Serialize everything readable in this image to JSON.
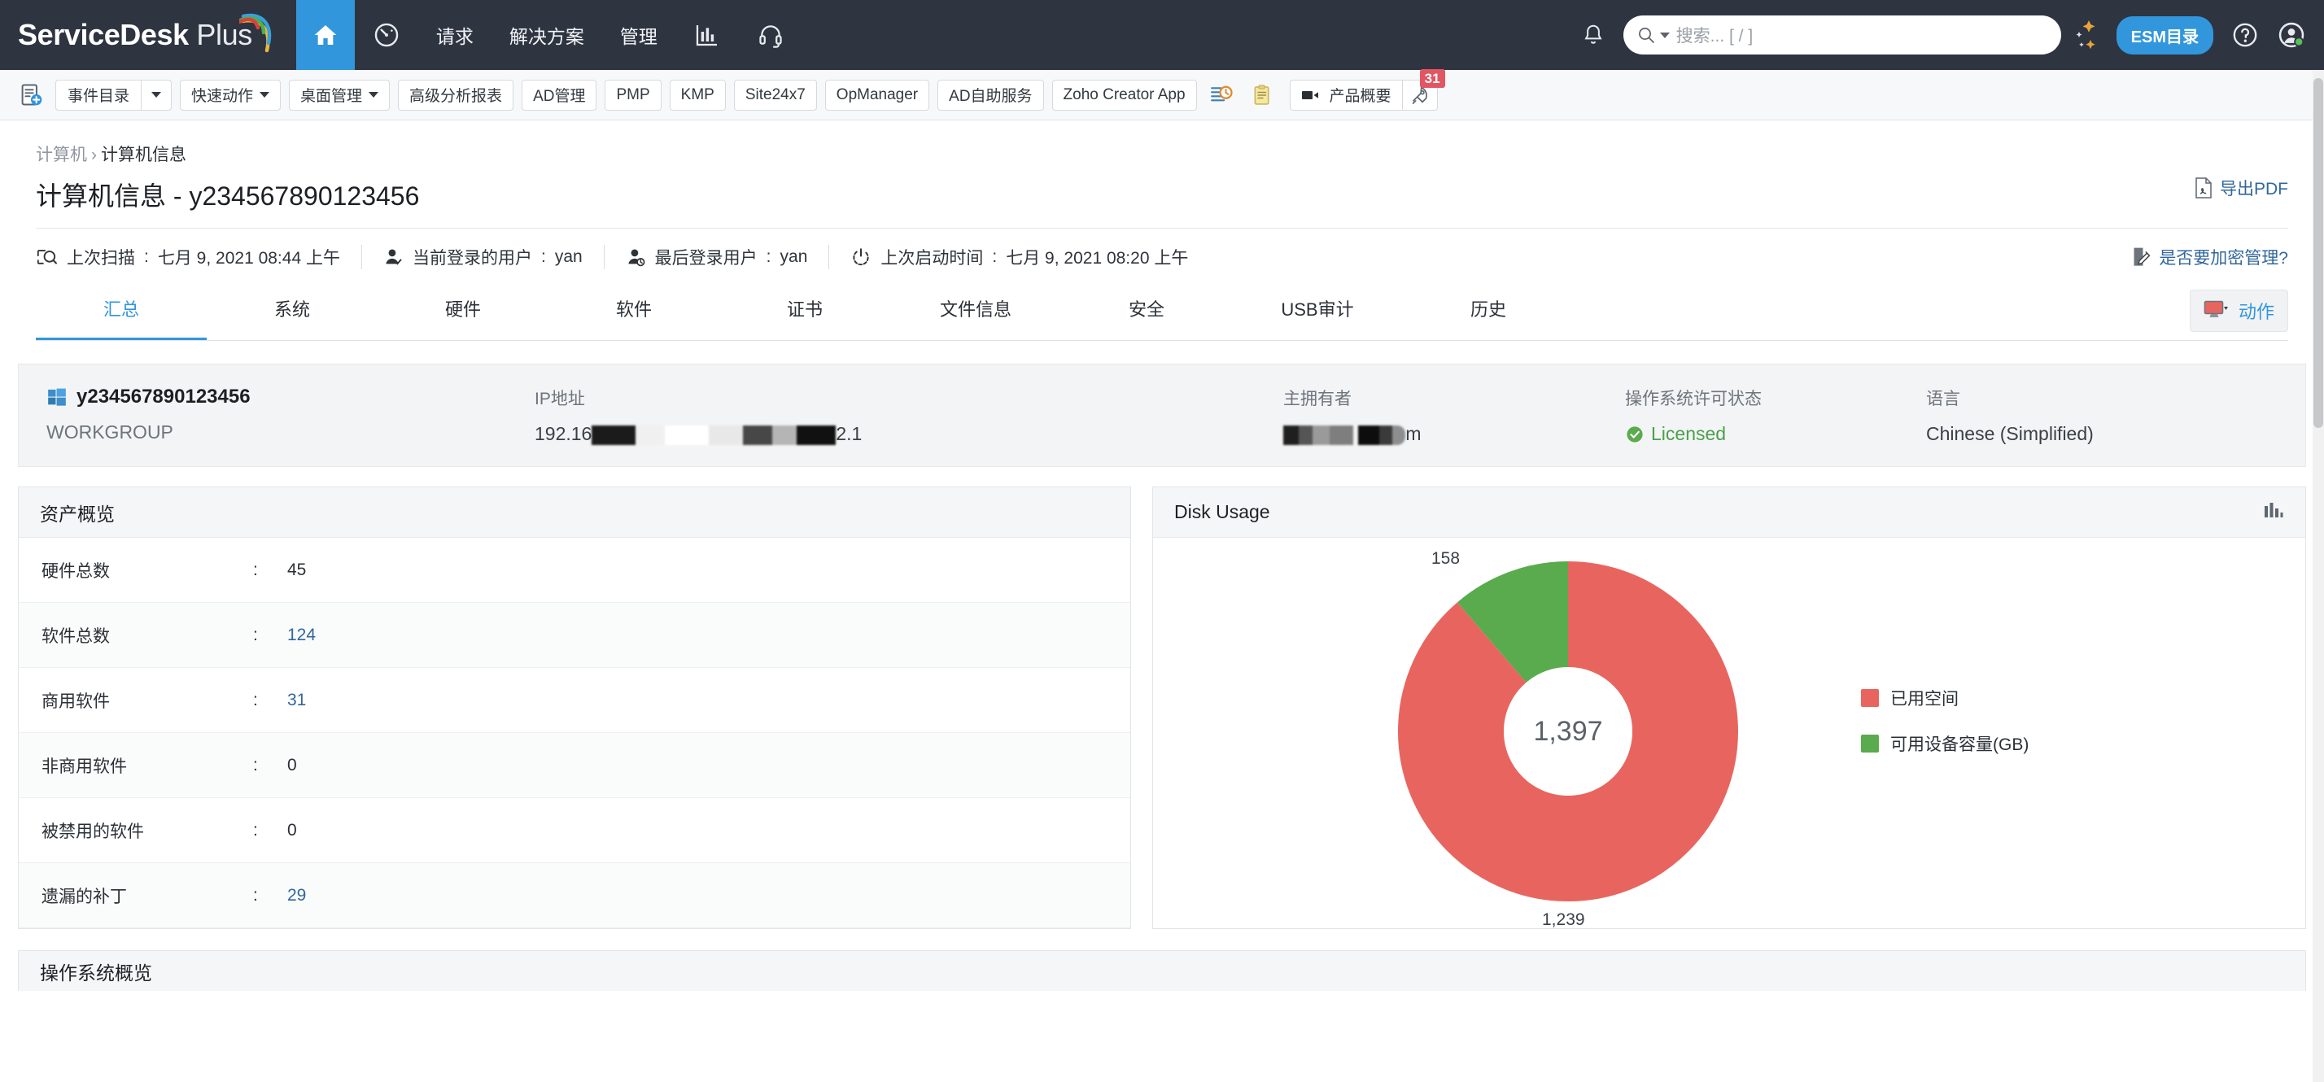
{
  "topnav": {
    "brand": "ServiceDesk",
    "brand_suffix": " Plus",
    "home_icon": "home-icon",
    "dashboard_icon": "gauge-icon",
    "items": [
      {
        "label": "请求",
        "icon": ""
      },
      {
        "label": "解决方案",
        "icon": ""
      },
      {
        "label": "管理",
        "icon": ""
      }
    ],
    "reports_icon": "bar-chart-icon",
    "support_icon": "headset-icon",
    "bell_icon": "bell-icon",
    "search": {
      "placeholder": "搜索... [ / ]",
      "icon": "search-icon"
    },
    "esm_button": "ESM目录",
    "help_icon": "question-circle-icon",
    "profile_icon": "user-avatar-icon",
    "accent_blue": "#3296dc",
    "bar_bg": "#2e3440"
  },
  "subbar": {
    "new_request_icon": "new-request-icon",
    "split_buttons": [
      {
        "label": "事件目录"
      },
      {
        "label": "快速动作"
      },
      {
        "label": "桌面管理"
      }
    ],
    "buttons": [
      "高级分析报表",
      "AD管理",
      "PMP",
      "KMP",
      "Site24x7",
      "OpManager",
      "AD自助服务",
      "Zoho Creator App"
    ],
    "icon_buttons": [
      {
        "name": "schedule-icon"
      },
      {
        "name": "clipboard-icon"
      }
    ],
    "product_overview": {
      "label": "产品概要",
      "video_icon": "video-camera-icon",
      "rocket_icon": "rocket-icon",
      "badge": "31",
      "badge_color": "#e25563"
    }
  },
  "breadcrumb": {
    "parent": "计算机",
    "separator": "›",
    "current": "计算机信息"
  },
  "header": {
    "title": "计算机信息 - y234567890123456",
    "export_pdf": {
      "label": "导出PDF",
      "icon": "pdf-file-icon"
    },
    "encrypt_link": {
      "label": "是否要加密管理?",
      "icon": "edit-note-icon"
    }
  },
  "meta": [
    {
      "icon": "scan-monitor-icon",
      "label": "上次扫描",
      "value": "七月 9, 2021 08:44 上午"
    },
    {
      "icon": "user-check-icon",
      "label": "当前登录的用户",
      "value": "yan"
    },
    {
      "icon": "user-clock-icon",
      "label": "最后登录用户",
      "value": "yan"
    },
    {
      "icon": "power-icon",
      "label": "上次启动时间",
      "value": "七月 9, 2021 08:20 上午"
    }
  ],
  "tabs": {
    "items": [
      "汇总",
      "系统",
      "硬件",
      "软件",
      "证书",
      "文件信息",
      "安全",
      "USB审计",
      "历史"
    ],
    "active_index": 0,
    "action_button": {
      "label": "动作",
      "icon": "remote-monitor-icon"
    }
  },
  "info_card": {
    "hostname": "y234567890123456",
    "hostname_icon": "windows-logo-icon",
    "workgroup": "WORKGROUP",
    "ip_label": "IP地址",
    "ip_value_prefix": "192.16",
    "ip_value_suffix": "2.1",
    "ip_redacted": true,
    "owner_label": "主拥有者",
    "owner_value_redacted": true,
    "owner_value_suffix": "m",
    "os_license_label": "操作系统许可状态",
    "os_license_value": "Licensed",
    "os_license_color": "#4aa04a",
    "language_label": "语言",
    "language_value": "Chinese (Simplified)"
  },
  "asset_overview": {
    "title": "资产概览",
    "rows": [
      {
        "label": "硬件总数",
        "sep": ":",
        "value": "45",
        "link": false
      },
      {
        "label": "软件总数",
        "sep": ":",
        "value": "124",
        "link": true
      },
      {
        "label": "商用软件",
        "sep": ":",
        "value": "31",
        "link": true
      },
      {
        "label": "非商用软件",
        "sep": ":",
        "value": "0",
        "link": false
      },
      {
        "label": "被禁用的软件",
        "sep": ":",
        "value": "0",
        "link": false
      },
      {
        "label": "遗漏的补丁",
        "sep": ":",
        "value": "29",
        "link": true
      }
    ]
  },
  "disk_usage_panel": {
    "title": "Disk Usage",
    "menu_icon": "chart-bars-icon"
  },
  "bottom_panel": {
    "title": "操作系统概览"
  },
  "chart_data": {
    "type": "pie",
    "title": "Disk Usage",
    "subtype": "donut",
    "center_label": "1,397",
    "total": 1397,
    "categories": [
      "已用空间",
      "可用设备容量(GB)"
    ],
    "values": [
      1239,
      158
    ],
    "data_labels": [
      "1,239",
      "158"
    ],
    "colors": [
      "#e8655f",
      "#5aab4e"
    ],
    "legend": {
      "position": "right",
      "entries": [
        "已用空间",
        "可用设备容量(GB)"
      ]
    },
    "grid": false,
    "xlabel": "",
    "ylabel": ""
  }
}
